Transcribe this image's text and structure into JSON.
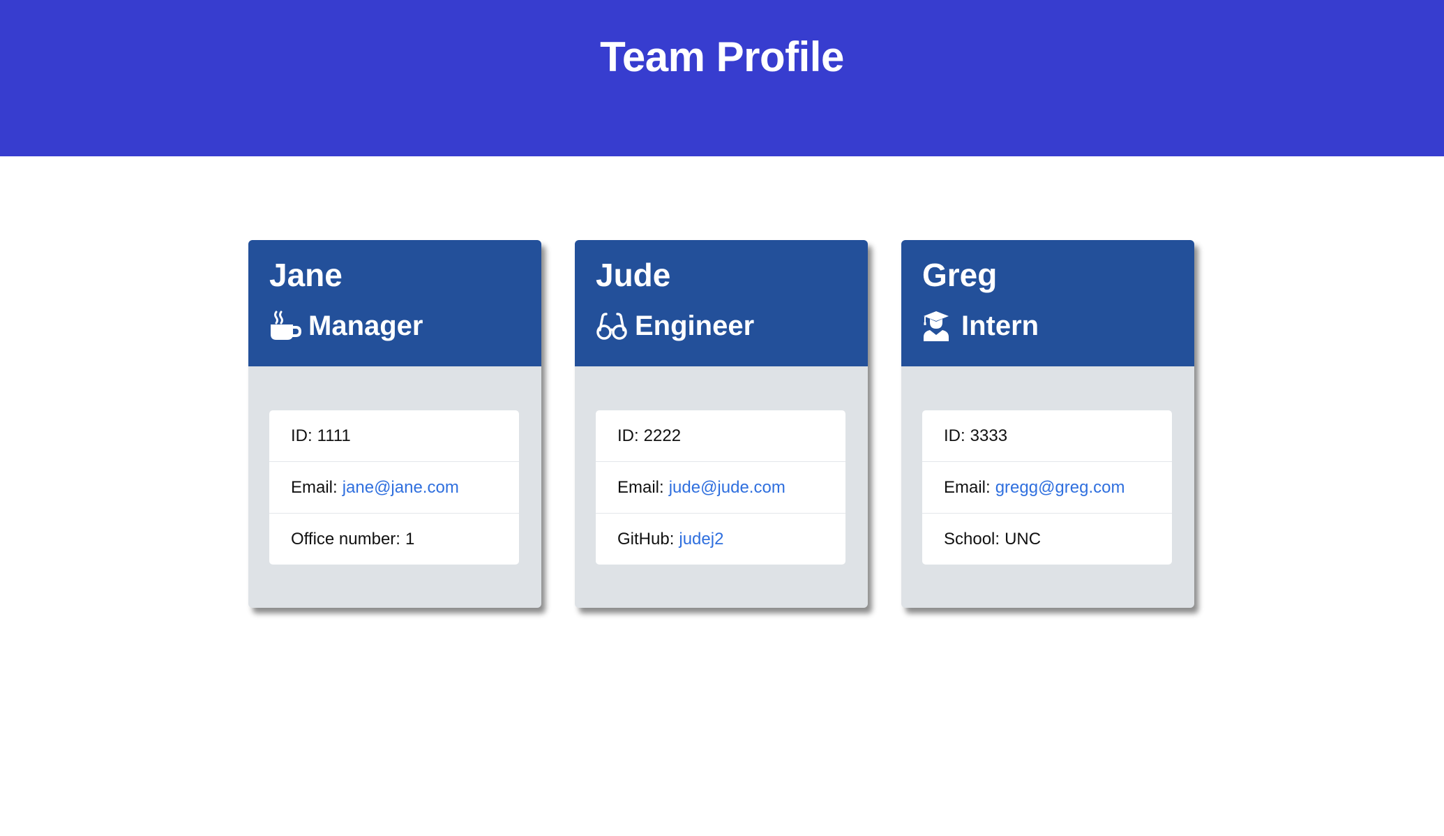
{
  "page": {
    "title": "Team Profile"
  },
  "colors": {
    "header_bg": "#373dcf",
    "card_head_bg": "#23509a",
    "card_body_bg": "#dee2e6",
    "link": "#2f6fde"
  },
  "team": [
    {
      "name": "Jane",
      "role": "Manager",
      "icon": "coffee-mug-icon",
      "id_label": "ID:",
      "id": "1111",
      "email_label": "Email:",
      "email": "jane@jane.com",
      "extra_label": "Office number:",
      "extra_value": "1"
    },
    {
      "name": "Jude",
      "role": "Engineer",
      "icon": "glasses-icon",
      "id_label": "ID:",
      "id": "2222",
      "email_label": "Email:",
      "email": "jude@jude.com",
      "extra_label": "GitHub:",
      "extra_value": "judej2"
    },
    {
      "name": "Greg",
      "role": "Intern",
      "icon": "graduate-icon",
      "id_label": "ID:",
      "id": "3333",
      "email_label": "Email:",
      "email": "gregg@greg.com",
      "extra_label": "School:",
      "extra_value": "UNC"
    }
  ]
}
